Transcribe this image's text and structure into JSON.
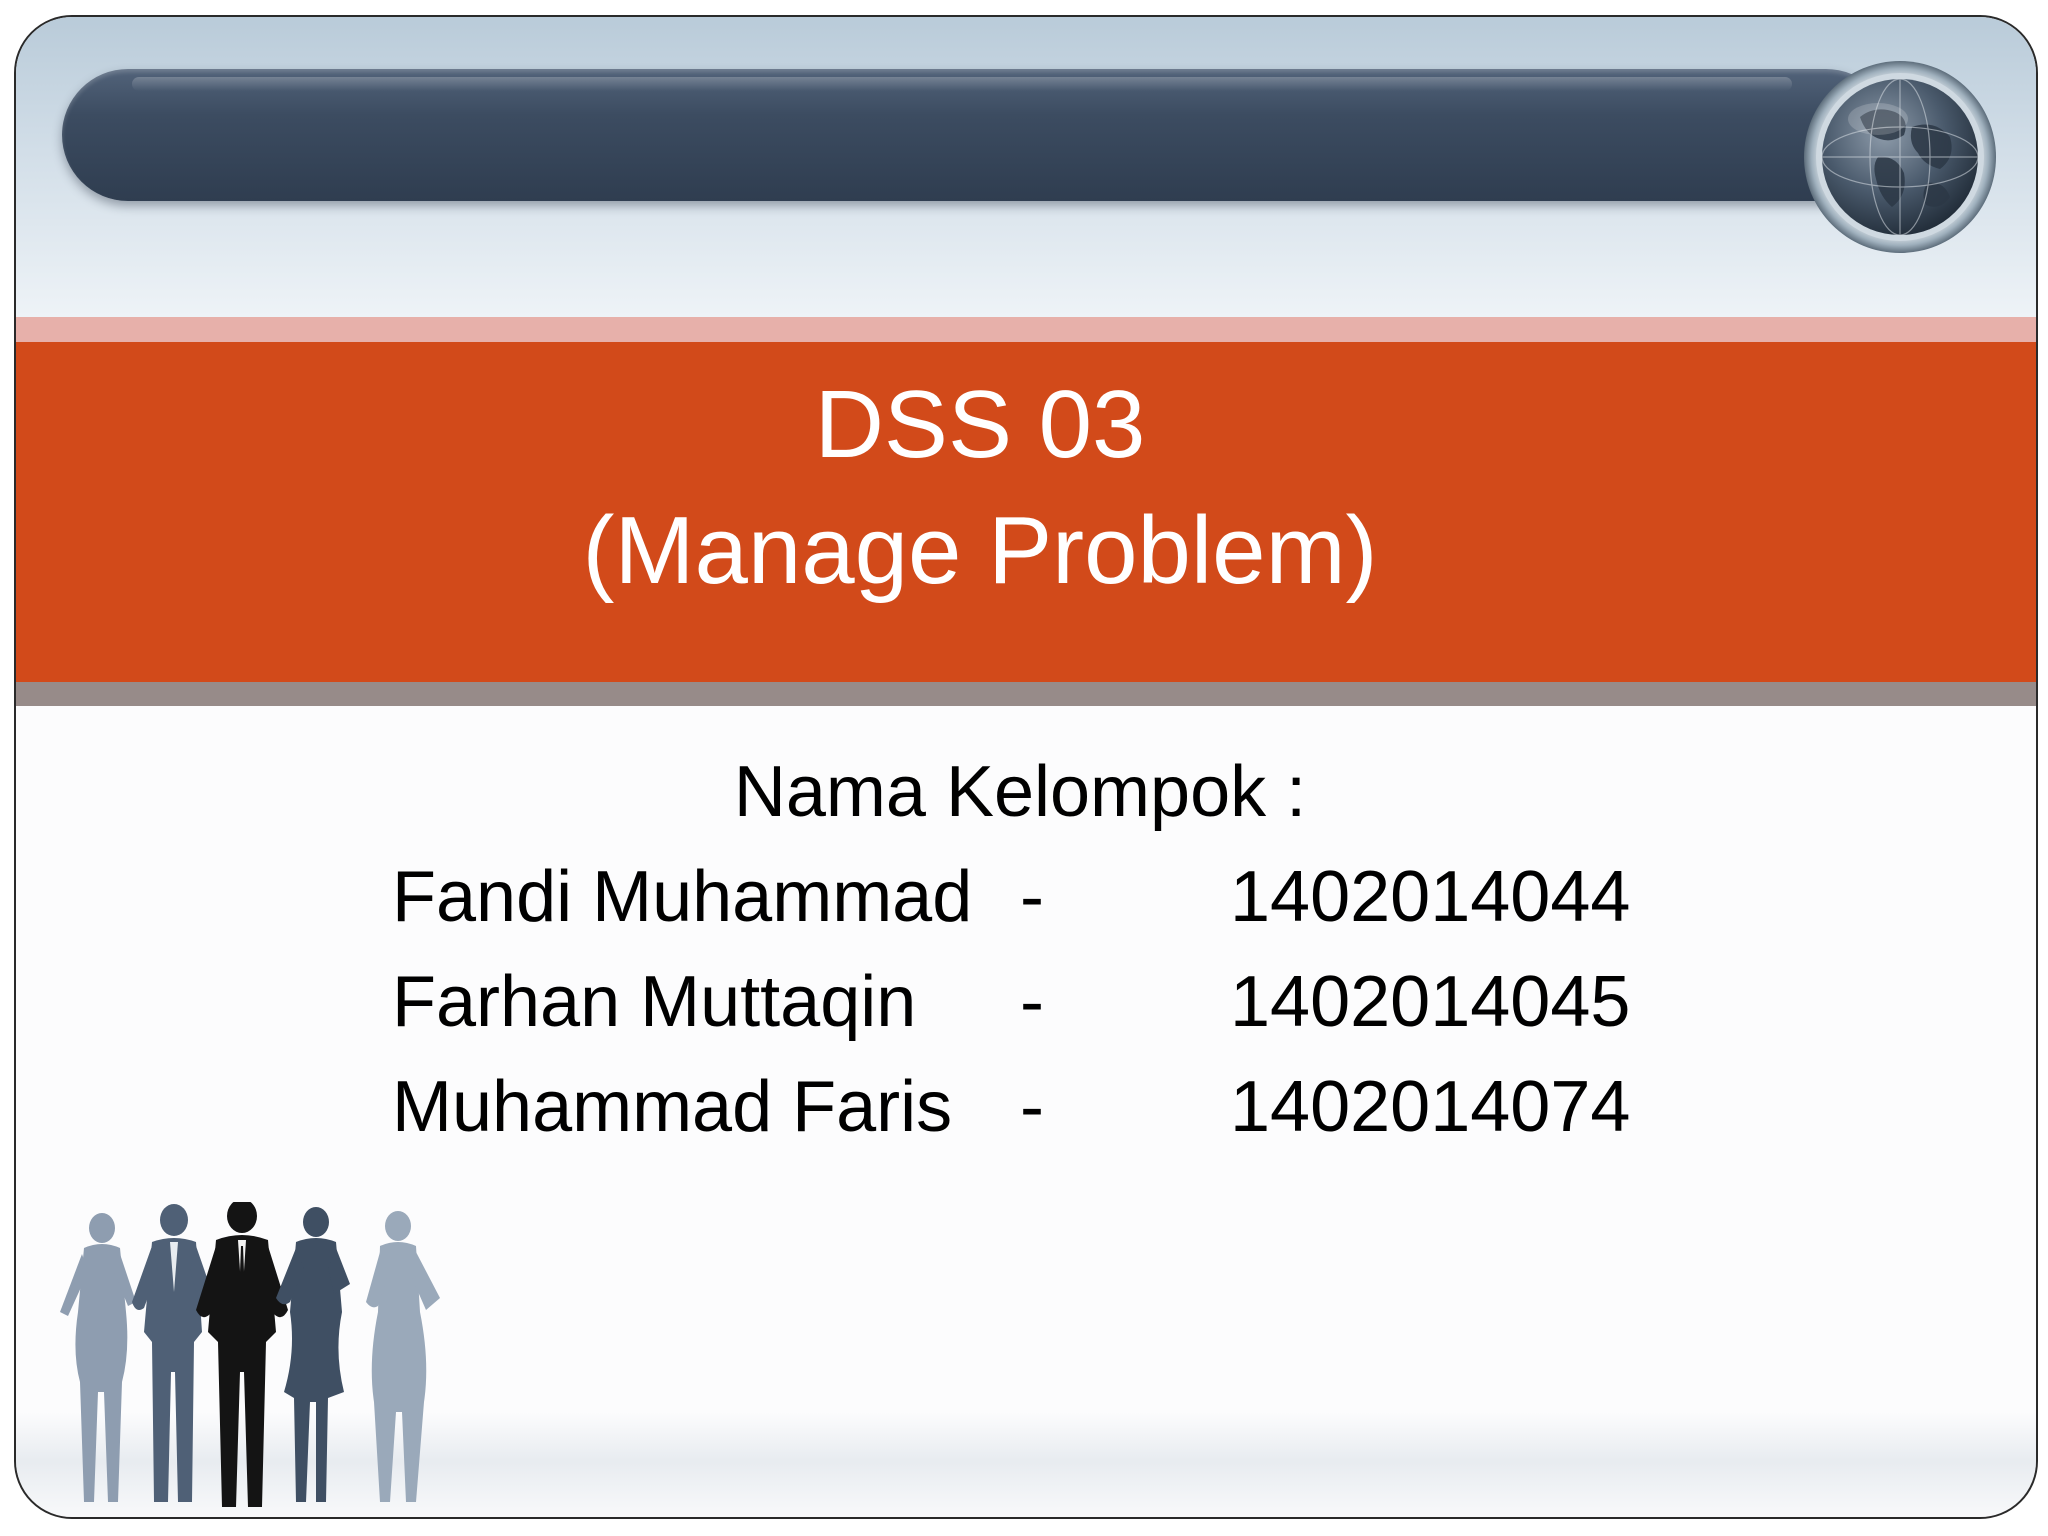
{
  "slide": {
    "title_line1": "DSS 03",
    "title_line2": "(Manage Problem)",
    "group_heading": "Nama Kelompok :",
    "members": [
      {
        "name": "Fandi Muhammad",
        "separator": "-",
        "nim": "1402014044"
      },
      {
        "name": "Farhan Muttaqin",
        "separator": "-",
        "nim": "1402014045"
      },
      {
        "name": "Muhammad Faris",
        "separator": "-",
        "nim": "1402014074"
      }
    ]
  },
  "decorations": {
    "header_bar_icon": "globe-icon",
    "footer_image": "business-people-silhouettes"
  },
  "colors": {
    "title_band": "#d24a1a",
    "header_bar": "#3c4c61",
    "pink_strip": "#e7b0aa",
    "gray_strip": "#978b89",
    "title_text": "#ffffff",
    "body_text": "#000000"
  }
}
